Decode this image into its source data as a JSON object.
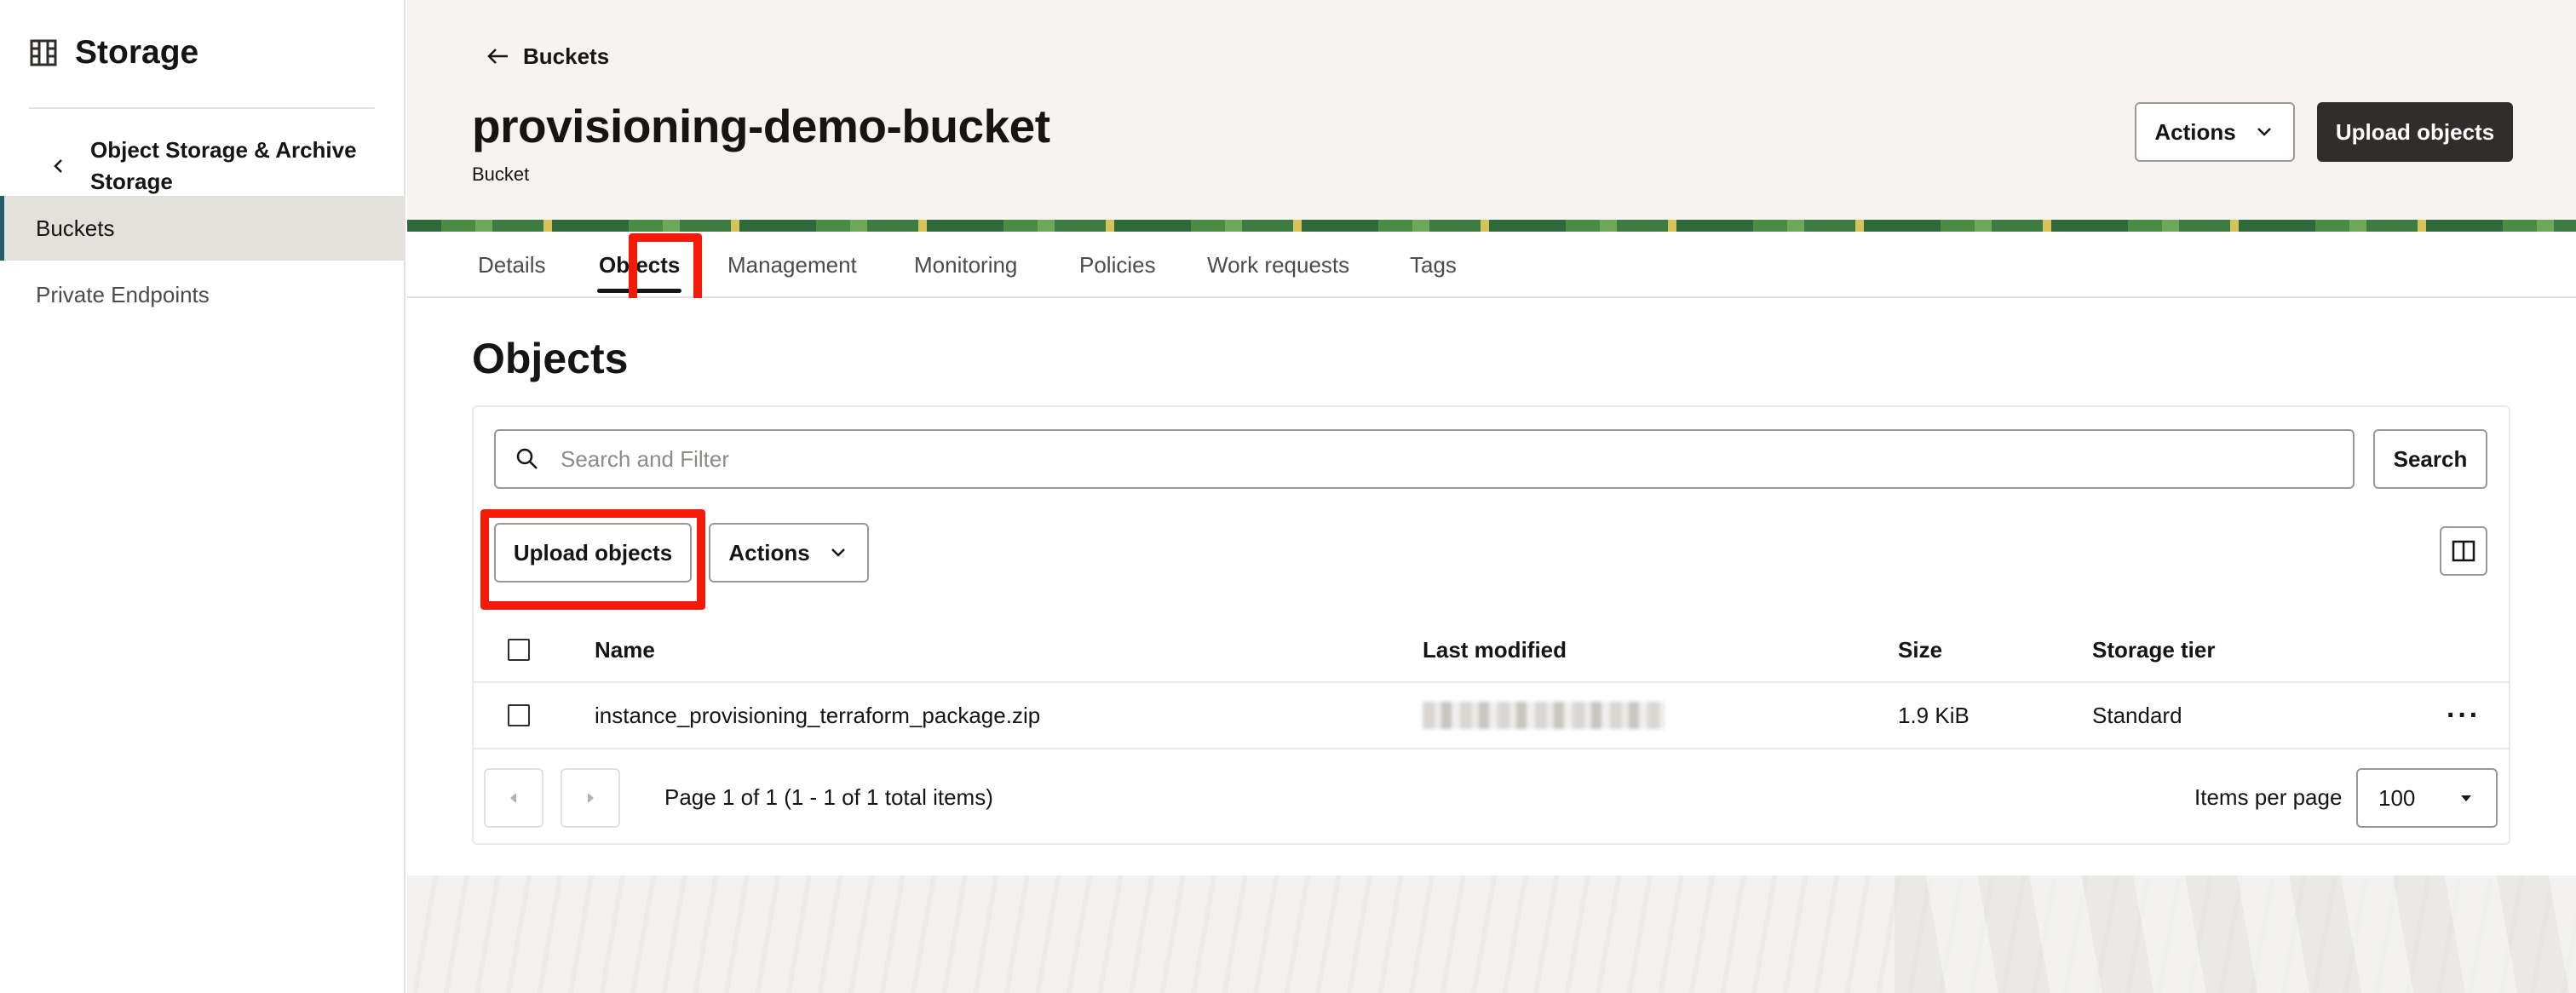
{
  "sidebar": {
    "title": "Storage",
    "title_icon": "storage-grid-icon",
    "back_label": "Object Storage & Archive Storage",
    "items": [
      {
        "label": "Buckets",
        "active": true
      },
      {
        "label": "Private Endpoints",
        "active": false
      }
    ]
  },
  "header": {
    "breadcrumb": "Buckets",
    "title": "provisioning-demo-bucket",
    "subtitle": "Bucket",
    "actions_label": "Actions",
    "upload_label": "Upload objects"
  },
  "tabs": [
    "Details",
    "Objects",
    "Management",
    "Monitoring",
    "Policies",
    "Work requests",
    "Tags"
  ],
  "active_tab": "Objects",
  "objects": {
    "title": "Objects",
    "search_placeholder": "Search and Filter",
    "search_button": "Search",
    "upload_button": "Upload objects",
    "actions_button": "Actions",
    "columns": [
      "Name",
      "Last modified",
      "Size",
      "Storage tier"
    ],
    "rows": [
      {
        "name": "instance_provisioning_terraform_package.zip",
        "last_modified": "",
        "size": "1.9 KiB",
        "tier": "Standard"
      }
    ],
    "pagination": {
      "text": "Page 1 of 1 (1 - 1 of 1 total items)",
      "items_per_page_label": "Items per page",
      "items_per_page": "100"
    }
  },
  "colors": {
    "highlight": "#f41a08",
    "primary_button": "#312d2a",
    "sidebar_active_bg": "#e4e1dd",
    "sidebar_active_bar": "#2c5967"
  }
}
